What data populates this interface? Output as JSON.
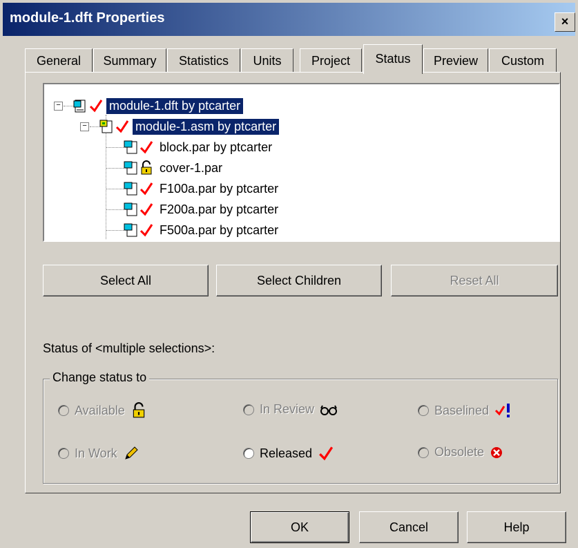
{
  "window": {
    "title": "module-1.dft Properties",
    "close_symbol": "×"
  },
  "tabs": [
    {
      "label": "General"
    },
    {
      "label": "Summary"
    },
    {
      "label": "Statistics"
    },
    {
      "label": "Units"
    },
    {
      "label": "Project"
    },
    {
      "label": "Status",
      "active": true
    },
    {
      "label": "Preview"
    },
    {
      "label": "Custom"
    }
  ],
  "tree": {
    "items": [
      {
        "label": "module-1.dft by ptcarter",
        "icon": "draft-doc-icon",
        "status": "released-check-icon",
        "selected": true
      },
      {
        "label": "module-1.asm by ptcarter",
        "icon": "assembly-doc-icon",
        "status": "released-check-icon",
        "selected": true
      },
      {
        "label": "block.par by ptcarter",
        "icon": "part-doc-icon",
        "status": "released-check-icon"
      },
      {
        "label": "cover-1.par",
        "icon": "part-doc-icon",
        "status": "available-lock-icon"
      },
      {
        "label": "F100a.par by ptcarter",
        "icon": "part-doc-icon",
        "status": "released-check-icon"
      },
      {
        "label": "F200a.par by ptcarter",
        "icon": "part-doc-icon",
        "status": "released-check-icon"
      },
      {
        "label": "F500a.par by ptcarter",
        "icon": "part-doc-icon",
        "status": "released-check-icon"
      }
    ]
  },
  "buttons": {
    "select_all": "Select All",
    "select_children": "Select Children",
    "reset_all": "Reset All"
  },
  "status_of": "Status of  <multiple selections>:",
  "change_status": {
    "group_label": "Change status to",
    "options": [
      {
        "label": "Available",
        "enabled": false,
        "icon": "lock-icon"
      },
      {
        "label": "In Review",
        "enabled": false,
        "icon": "glasses-icon"
      },
      {
        "label": "Baselined",
        "enabled": false,
        "icon": "check-exclamation-icon"
      },
      {
        "label": "In Work",
        "enabled": false,
        "icon": "pencil-icon"
      },
      {
        "label": "Released",
        "enabled": true,
        "icon": "check-icon"
      },
      {
        "label": "Obsolete",
        "enabled": false,
        "icon": "red-x-icon"
      }
    ]
  },
  "footer": {
    "ok": "OK",
    "cancel": "Cancel",
    "help": "Help"
  },
  "colors": {
    "selection": "#0a246a",
    "check": "#ff0000",
    "dialog_bg": "#d4d0c8"
  }
}
